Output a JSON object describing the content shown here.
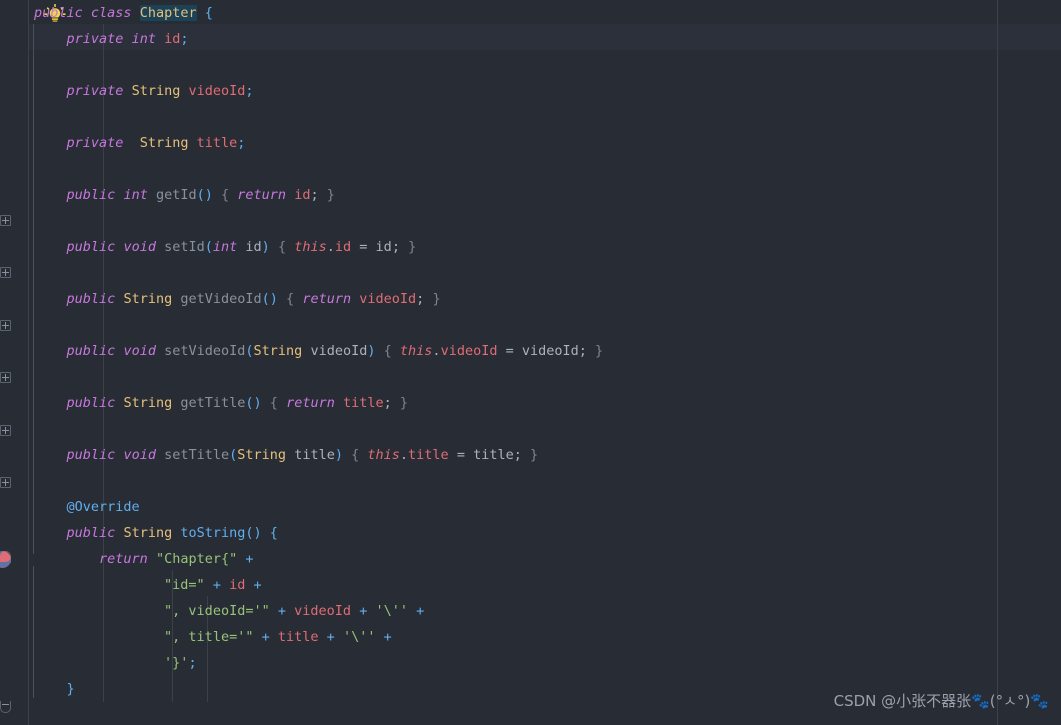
{
  "editor": {
    "theme_background": "#282c34",
    "current_line_background": "#2b303b",
    "selection_background": "#1c4257",
    "gutter_separator_color": "#3b4049",
    "language": "Java",
    "class_name": "Chapter"
  },
  "icons": {
    "lightbulb": "lightbulb-icon",
    "run_gutter": "run-gutter-icon",
    "fold_expand": "fold-expand-icon",
    "fold_collapse": "fold-collapse-icon"
  },
  "code": {
    "lines": [
      {
        "n": 1,
        "tokens": [
          {
            "t": "public",
            "c": "kw"
          },
          {
            "t": " ",
            "c": "var"
          },
          {
            "t": "class",
            "c": "kw"
          },
          {
            "t": " ",
            "c": "var"
          },
          {
            "t": "Chapter",
            "c": "sel"
          },
          {
            "t": " ",
            "c": "var"
          },
          {
            "t": "{",
            "c": "br"
          }
        ]
      },
      {
        "n": 2,
        "tokens": [
          {
            "t": "    ",
            "c": "var"
          },
          {
            "t": "private",
            "c": "kw"
          },
          {
            "t": " ",
            "c": "var"
          },
          {
            "t": "int",
            "c": "kw"
          },
          {
            "t": " ",
            "c": "var"
          },
          {
            "t": "id",
            "c": "fld"
          },
          {
            "t": ";",
            "c": "br"
          }
        ]
      },
      {
        "n": 3,
        "tokens": []
      },
      {
        "n": 4,
        "tokens": [
          {
            "t": "    ",
            "c": "var"
          },
          {
            "t": "private",
            "c": "kw"
          },
          {
            "t": " ",
            "c": "var"
          },
          {
            "t": "String",
            "c": "type"
          },
          {
            "t": " ",
            "c": "var"
          },
          {
            "t": "videoId",
            "c": "fld"
          },
          {
            "t": ";",
            "c": "br"
          }
        ]
      },
      {
        "n": 5,
        "tokens": []
      },
      {
        "n": 6,
        "tokens": [
          {
            "t": "    ",
            "c": "var"
          },
          {
            "t": "private",
            "c": "kw"
          },
          {
            "t": "  ",
            "c": "var"
          },
          {
            "t": "String",
            "c": "type"
          },
          {
            "t": " ",
            "c": "var"
          },
          {
            "t": "title",
            "c": "fld"
          },
          {
            "t": ";",
            "c": "br"
          }
        ]
      },
      {
        "n": 7,
        "tokens": []
      },
      {
        "n": 8,
        "tokens": [
          {
            "t": "    ",
            "c": "var"
          },
          {
            "t": "public",
            "c": "kw"
          },
          {
            "t": " ",
            "c": "var"
          },
          {
            "t": "int",
            "c": "kw"
          },
          {
            "t": " ",
            "c": "var"
          },
          {
            "t": "getId",
            "c": "mth"
          },
          {
            "t": "()",
            "c": "br"
          },
          {
            "t": " ",
            "c": "var"
          },
          {
            "t": "{",
            "c": "punc"
          },
          {
            "t": " ",
            "c": "var"
          },
          {
            "t": "return",
            "c": "kw"
          },
          {
            "t": " ",
            "c": "var"
          },
          {
            "t": "id",
            "c": "fld"
          },
          {
            "t": ";",
            "c": "var"
          },
          {
            "t": " ",
            "c": "var"
          },
          {
            "t": "}",
            "c": "punc"
          }
        ]
      },
      {
        "n": 9,
        "tokens": []
      },
      {
        "n": 10,
        "tokens": [
          {
            "t": "    ",
            "c": "var"
          },
          {
            "t": "public",
            "c": "kw"
          },
          {
            "t": " ",
            "c": "var"
          },
          {
            "t": "void",
            "c": "kw"
          },
          {
            "t": " ",
            "c": "var"
          },
          {
            "t": "setId",
            "c": "mth"
          },
          {
            "t": "(",
            "c": "br"
          },
          {
            "t": "int",
            "c": "kw"
          },
          {
            "t": " ",
            "c": "var"
          },
          {
            "t": "id",
            "c": "var"
          },
          {
            "t": ")",
            "c": "br"
          },
          {
            "t": " ",
            "c": "var"
          },
          {
            "t": "{",
            "c": "punc"
          },
          {
            "t": " ",
            "c": "var"
          },
          {
            "t": "this",
            "c": "thisk"
          },
          {
            "t": ".",
            "c": "var"
          },
          {
            "t": "id",
            "c": "fld"
          },
          {
            "t": " = ",
            "c": "var"
          },
          {
            "t": "id",
            "c": "var"
          },
          {
            "t": ";",
            "c": "var"
          },
          {
            "t": " ",
            "c": "var"
          },
          {
            "t": "}",
            "c": "punc"
          }
        ]
      },
      {
        "n": 11,
        "tokens": []
      },
      {
        "n": 12,
        "tokens": [
          {
            "t": "    ",
            "c": "var"
          },
          {
            "t": "public",
            "c": "kw"
          },
          {
            "t": " ",
            "c": "var"
          },
          {
            "t": "String",
            "c": "type"
          },
          {
            "t": " ",
            "c": "var"
          },
          {
            "t": "getVideoId",
            "c": "mth"
          },
          {
            "t": "()",
            "c": "br"
          },
          {
            "t": " ",
            "c": "var"
          },
          {
            "t": "{",
            "c": "punc"
          },
          {
            "t": " ",
            "c": "var"
          },
          {
            "t": "return",
            "c": "kw"
          },
          {
            "t": " ",
            "c": "var"
          },
          {
            "t": "videoId",
            "c": "fld"
          },
          {
            "t": ";",
            "c": "var"
          },
          {
            "t": " ",
            "c": "var"
          },
          {
            "t": "}",
            "c": "punc"
          }
        ]
      },
      {
        "n": 13,
        "tokens": []
      },
      {
        "n": 14,
        "tokens": [
          {
            "t": "    ",
            "c": "var"
          },
          {
            "t": "public",
            "c": "kw"
          },
          {
            "t": " ",
            "c": "var"
          },
          {
            "t": "void",
            "c": "kw"
          },
          {
            "t": " ",
            "c": "var"
          },
          {
            "t": "setVideoId",
            "c": "mth"
          },
          {
            "t": "(",
            "c": "br"
          },
          {
            "t": "String",
            "c": "type"
          },
          {
            "t": " ",
            "c": "var"
          },
          {
            "t": "videoId",
            "c": "var"
          },
          {
            "t": ")",
            "c": "br"
          },
          {
            "t": " ",
            "c": "var"
          },
          {
            "t": "{",
            "c": "punc"
          },
          {
            "t": " ",
            "c": "var"
          },
          {
            "t": "this",
            "c": "thisk"
          },
          {
            "t": ".",
            "c": "var"
          },
          {
            "t": "videoId",
            "c": "fld"
          },
          {
            "t": " = ",
            "c": "var"
          },
          {
            "t": "videoId",
            "c": "var"
          },
          {
            "t": ";",
            "c": "var"
          },
          {
            "t": " ",
            "c": "var"
          },
          {
            "t": "}",
            "c": "punc"
          }
        ]
      },
      {
        "n": 15,
        "tokens": []
      },
      {
        "n": 16,
        "tokens": [
          {
            "t": "    ",
            "c": "var"
          },
          {
            "t": "public",
            "c": "kw"
          },
          {
            "t": " ",
            "c": "var"
          },
          {
            "t": "String",
            "c": "type"
          },
          {
            "t": " ",
            "c": "var"
          },
          {
            "t": "getTitle",
            "c": "mth"
          },
          {
            "t": "()",
            "c": "br"
          },
          {
            "t": " ",
            "c": "var"
          },
          {
            "t": "{",
            "c": "punc"
          },
          {
            "t": " ",
            "c": "var"
          },
          {
            "t": "return",
            "c": "kw"
          },
          {
            "t": " ",
            "c": "var"
          },
          {
            "t": "title",
            "c": "fld"
          },
          {
            "t": ";",
            "c": "var"
          },
          {
            "t": " ",
            "c": "var"
          },
          {
            "t": "}",
            "c": "punc"
          }
        ]
      },
      {
        "n": 17,
        "tokens": []
      },
      {
        "n": 18,
        "tokens": [
          {
            "t": "    ",
            "c": "var"
          },
          {
            "t": "public",
            "c": "kw"
          },
          {
            "t": " ",
            "c": "var"
          },
          {
            "t": "void",
            "c": "kw"
          },
          {
            "t": " ",
            "c": "var"
          },
          {
            "t": "setTitle",
            "c": "mth"
          },
          {
            "t": "(",
            "c": "br"
          },
          {
            "t": "String",
            "c": "type"
          },
          {
            "t": " ",
            "c": "var"
          },
          {
            "t": "title",
            "c": "var"
          },
          {
            "t": ")",
            "c": "br"
          },
          {
            "t": " ",
            "c": "var"
          },
          {
            "t": "{",
            "c": "punc"
          },
          {
            "t": " ",
            "c": "var"
          },
          {
            "t": "this",
            "c": "thisk"
          },
          {
            "t": ".",
            "c": "var"
          },
          {
            "t": "title",
            "c": "fld"
          },
          {
            "t": " = ",
            "c": "var"
          },
          {
            "t": "title",
            "c": "var"
          },
          {
            "t": ";",
            "c": "var"
          },
          {
            "t": " ",
            "c": "var"
          },
          {
            "t": "}",
            "c": "punc"
          }
        ]
      },
      {
        "n": 19,
        "tokens": []
      },
      {
        "n": 20,
        "tokens": [
          {
            "t": "    ",
            "c": "var"
          },
          {
            "t": "@Override",
            "c": "ann"
          }
        ]
      },
      {
        "n": 21,
        "tokens": [
          {
            "t": "    ",
            "c": "var"
          },
          {
            "t": "public",
            "c": "kw"
          },
          {
            "t": " ",
            "c": "var"
          },
          {
            "t": "String",
            "c": "type"
          },
          {
            "t": " ",
            "c": "var"
          },
          {
            "t": "toString",
            "c": "br"
          },
          {
            "t": "()",
            "c": "br"
          },
          {
            "t": " ",
            "c": "var"
          },
          {
            "t": "{",
            "c": "br"
          }
        ]
      },
      {
        "n": 22,
        "tokens": [
          {
            "t": "        ",
            "c": "var"
          },
          {
            "t": "return",
            "c": "kw"
          },
          {
            "t": " ",
            "c": "var"
          },
          {
            "t": "\"Chapter{\"",
            "c": "str"
          },
          {
            "t": " ",
            "c": "var"
          },
          {
            "t": "+",
            "c": "op"
          }
        ]
      },
      {
        "n": 23,
        "tokens": [
          {
            "t": "                ",
            "c": "var"
          },
          {
            "t": "\"id=\"",
            "c": "str"
          },
          {
            "t": " ",
            "c": "var"
          },
          {
            "t": "+",
            "c": "op"
          },
          {
            "t": " ",
            "c": "var"
          },
          {
            "t": "id",
            "c": "fld"
          },
          {
            "t": " ",
            "c": "var"
          },
          {
            "t": "+",
            "c": "op"
          }
        ]
      },
      {
        "n": 24,
        "tokens": [
          {
            "t": "                ",
            "c": "var"
          },
          {
            "t": "\", videoId='\"",
            "c": "str"
          },
          {
            "t": " ",
            "c": "var"
          },
          {
            "t": "+",
            "c": "op"
          },
          {
            "t": " ",
            "c": "var"
          },
          {
            "t": "videoId",
            "c": "fld"
          },
          {
            "t": " ",
            "c": "var"
          },
          {
            "t": "+",
            "c": "op"
          },
          {
            "t": " ",
            "c": "var"
          },
          {
            "t": "'\\''",
            "c": "str"
          },
          {
            "t": " ",
            "c": "var"
          },
          {
            "t": "+",
            "c": "op"
          }
        ]
      },
      {
        "n": 25,
        "tokens": [
          {
            "t": "                ",
            "c": "var"
          },
          {
            "t": "\", title='\"",
            "c": "str"
          },
          {
            "t": " ",
            "c": "var"
          },
          {
            "t": "+",
            "c": "op"
          },
          {
            "t": " ",
            "c": "var"
          },
          {
            "t": "title",
            "c": "fld"
          },
          {
            "t": " ",
            "c": "var"
          },
          {
            "t": "+",
            "c": "op"
          },
          {
            "t": " ",
            "c": "var"
          },
          {
            "t": "'\\''",
            "c": "str"
          },
          {
            "t": " ",
            "c": "var"
          },
          {
            "t": "+",
            "c": "op"
          }
        ]
      },
      {
        "n": 26,
        "tokens": [
          {
            "t": "                ",
            "c": "var"
          },
          {
            "t": "'}'",
            "c": "str"
          },
          {
            "t": ";",
            "c": "br"
          }
        ]
      },
      {
        "n": 27,
        "tokens": [
          {
            "t": "    ",
            "c": "var"
          },
          {
            "t": "}",
            "c": "br"
          }
        ]
      }
    ]
  },
  "watermark": {
    "text": "CSDN @小张不器张🐾(°ㅅ°)🐾"
  }
}
